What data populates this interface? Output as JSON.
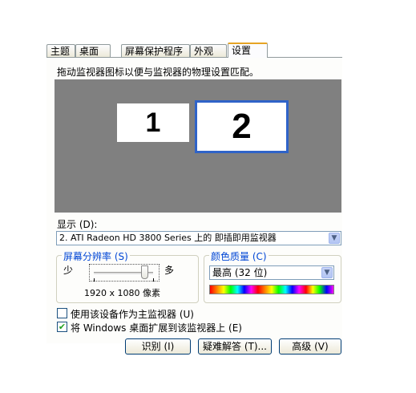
{
  "tabs": [
    {
      "label": "主题"
    },
    {
      "label": "桌面"
    },
    {
      "label": "屏幕保护程序"
    },
    {
      "label": "外观"
    },
    {
      "label": "设置"
    }
  ],
  "instruction": "拖动监视器图标以便与监视器的物理设置匹配。",
  "monitors": [
    {
      "number": "1"
    },
    {
      "number": "2"
    }
  ],
  "display": {
    "label": "显示 (D):",
    "value": "2. ATI Radeon HD 3800 Series  上的 即插即用监视器"
  },
  "resolution": {
    "title": "屏幕分辨率 (S)",
    "less": "少",
    "more": "多",
    "value": "1920 x 1080 像素",
    "slider_level": 0.85
  },
  "color_quality": {
    "title": "颜色质量 (C)",
    "value": "最高 (32 位)"
  },
  "options": {
    "primary_label": "使用该设备作为主监视器 (U)",
    "primary_checked": false,
    "extend_label": "将 Windows 桌面扩展到该监视器上 (E)",
    "extend_checked": true
  },
  "buttons": {
    "identify": "识别 (I)",
    "troubleshoot": "疑难解答 (T)...",
    "advanced": "高级 (V)"
  },
  "colors": {
    "preview_bg": "#808080",
    "selected_border": "#2f63c8",
    "group_title": "#0046d5"
  }
}
